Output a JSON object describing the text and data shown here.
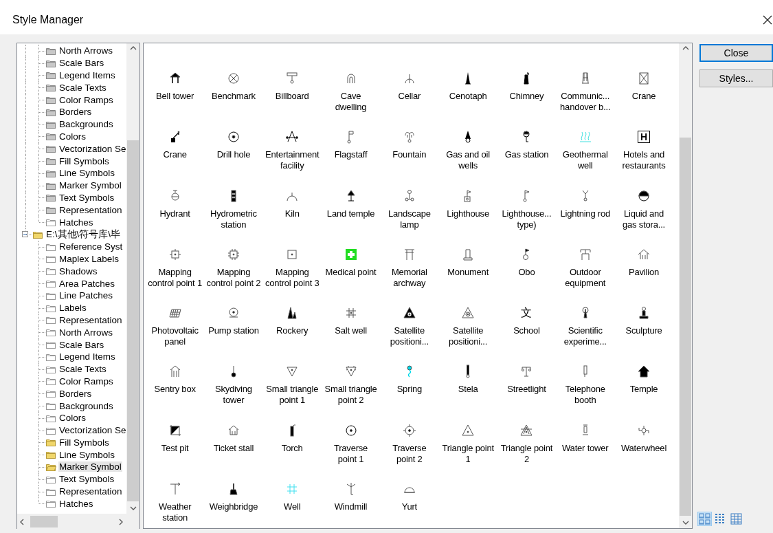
{
  "window": {
    "title": "Style Manager"
  },
  "tree": {
    "nodes": [
      {
        "children": [
          {
            "label": "North Arrows",
            "kind": "gray",
            "selected": false
          },
          {
            "label": "Scale Bars",
            "kind": "gray",
            "selected": false
          },
          {
            "label": "Legend Items",
            "kind": "gray",
            "selected": false
          },
          {
            "label": "Scale Texts",
            "kind": "gray",
            "selected": false
          },
          {
            "label": "Color Ramps",
            "kind": "gray",
            "selected": false
          },
          {
            "label": "Borders",
            "kind": "gray",
            "selected": false
          },
          {
            "label": "Backgrounds",
            "kind": "gray",
            "selected": false
          },
          {
            "label": "Colors",
            "kind": "gray",
            "selected": false
          },
          {
            "label": "Vectorization Se",
            "kind": "gray",
            "selected": false
          },
          {
            "label": "Fill Symbols",
            "kind": "gray",
            "selected": false
          },
          {
            "label": "Line Symbols",
            "kind": "gray",
            "selected": false
          },
          {
            "label": "Marker Symbol",
            "kind": "gray",
            "selected": false
          },
          {
            "label": "Text Symbols",
            "kind": "gray",
            "selected": false
          },
          {
            "label": "Representation",
            "kind": "gray",
            "selected": false
          },
          {
            "label": "Hatches",
            "kind": "white",
            "selected": false
          }
        ]
      },
      {
        "label": "E:\\其他\\符号库\\毕",
        "kind": "yellow",
        "expanded": true,
        "selected": false,
        "children": [
          {
            "label": "Reference Syst",
            "kind": "white",
            "selected": false
          },
          {
            "label": "Maplex Labels",
            "kind": "white",
            "selected": false
          },
          {
            "label": "Shadows",
            "kind": "white",
            "selected": false
          },
          {
            "label": "Area Patches",
            "kind": "white",
            "selected": false
          },
          {
            "label": "Line Patches",
            "kind": "white",
            "selected": false
          },
          {
            "label": "Labels",
            "kind": "white",
            "selected": false
          },
          {
            "label": "Representation",
            "kind": "white",
            "selected": false
          },
          {
            "label": "North Arrows",
            "kind": "white",
            "selected": false
          },
          {
            "label": "Scale Bars",
            "kind": "white",
            "selected": false
          },
          {
            "label": "Legend Items",
            "kind": "white",
            "selected": false
          },
          {
            "label": "Scale Texts",
            "kind": "white",
            "selected": false
          },
          {
            "label": "Color Ramps",
            "kind": "white",
            "selected": false
          },
          {
            "label": "Borders",
            "kind": "white",
            "selected": false
          },
          {
            "label": "Backgrounds",
            "kind": "white",
            "selected": false
          },
          {
            "label": "Colors",
            "kind": "white",
            "selected": false
          },
          {
            "label": "Vectorization Se",
            "kind": "white",
            "selected": false
          },
          {
            "label": "Fill Symbols",
            "kind": "yellow",
            "selected": false
          },
          {
            "label": "Line Symbols",
            "kind": "yellow",
            "selected": false
          },
          {
            "label": "Marker Symbol",
            "kind": "open",
            "selected": true
          },
          {
            "label": "Text Symbols",
            "kind": "white",
            "selected": false
          },
          {
            "label": "Representation",
            "kind": "white",
            "selected": false
          },
          {
            "label": "Hatches",
            "kind": "white",
            "selected": false
          }
        ]
      }
    ]
  },
  "symbols": [
    {
      "label": "Bell tower"
    },
    {
      "label": "Benchmark"
    },
    {
      "label": "Billboard"
    },
    {
      "label": "Cave\ndwelling"
    },
    {
      "label": "Cellar"
    },
    {
      "label": "Cenotaph"
    },
    {
      "label": "Chimney"
    },
    {
      "label": "Communic...\nhandover b..."
    },
    {
      "label": "Crane"
    },
    {
      "label": "Crane"
    },
    {
      "label": "Drill hole"
    },
    {
      "label": "Entertainment\nfacility"
    },
    {
      "label": "Flagstaff"
    },
    {
      "label": "Fountain"
    },
    {
      "label": "Gas and oil\nwells"
    },
    {
      "label": "Gas station"
    },
    {
      "label": "Geothermal\nwell"
    },
    {
      "label": "Hotels and\nrestaurants",
      "glyph": "H"
    },
    {
      "label": "Hydrant"
    },
    {
      "label": "Hydrometric\nstation"
    },
    {
      "label": "Kiln"
    },
    {
      "label": "Land temple"
    },
    {
      "label": "Landscape\nlamp"
    },
    {
      "label": "Lighthouse"
    },
    {
      "label": "Lighthouse...\ntype)"
    },
    {
      "label": "Lightning rod"
    },
    {
      "label": "Liquid and\ngas stora..."
    },
    {
      "label": "Mapping\ncontrol point 1"
    },
    {
      "label": "Mapping\ncontrol point 2"
    },
    {
      "label": "Mapping\ncontrol point 3"
    },
    {
      "label": "Medical point"
    },
    {
      "label": "Memorial\narchway"
    },
    {
      "label": "Monument"
    },
    {
      "label": "Obo"
    },
    {
      "label": "Outdoor\nequipment"
    },
    {
      "label": "Pavilion"
    },
    {
      "label": "Photovoltaic\npanel"
    },
    {
      "label": "Pump station"
    },
    {
      "label": "Rockery"
    },
    {
      "label": "Salt well"
    },
    {
      "label": "Satellite\npositioni..."
    },
    {
      "label": "Satellite\npositioni..."
    },
    {
      "label": "School",
      "glyph": "文"
    },
    {
      "label": "Scientific\nexperime..."
    },
    {
      "label": "Sculpture"
    },
    {
      "label": "Sentry box"
    },
    {
      "label": "Skydiving\ntower"
    },
    {
      "label": "Small triangle\npoint 1"
    },
    {
      "label": "Small triangle\npoint 2"
    },
    {
      "label": "Spring"
    },
    {
      "label": "Stela"
    },
    {
      "label": "Streetlight"
    },
    {
      "label": "Telephone\nbooth"
    },
    {
      "label": "Temple"
    },
    {
      "label": "Test pit"
    },
    {
      "label": "Ticket stall"
    },
    {
      "label": "Torch"
    },
    {
      "label": "Traverse\npoint 1"
    },
    {
      "label": "Traverse\npoint 2"
    },
    {
      "label": "Triangle point\n1"
    },
    {
      "label": "Triangle point\n2"
    },
    {
      "label": "Water tower"
    },
    {
      "label": "Waterwheel"
    },
    {
      "label": "Weather\nstation"
    },
    {
      "label": "Weighbridge"
    },
    {
      "label": "Well"
    },
    {
      "label": "Windmill"
    },
    {
      "label": "Yurt"
    }
  ],
  "buttons": [
    {
      "label": "Close",
      "default": true
    },
    {
      "label": "Styles...",
      "default": false
    }
  ],
  "view_buttons": [
    {
      "selected": true
    },
    {
      "selected": false
    },
    {
      "selected": false
    }
  ]
}
